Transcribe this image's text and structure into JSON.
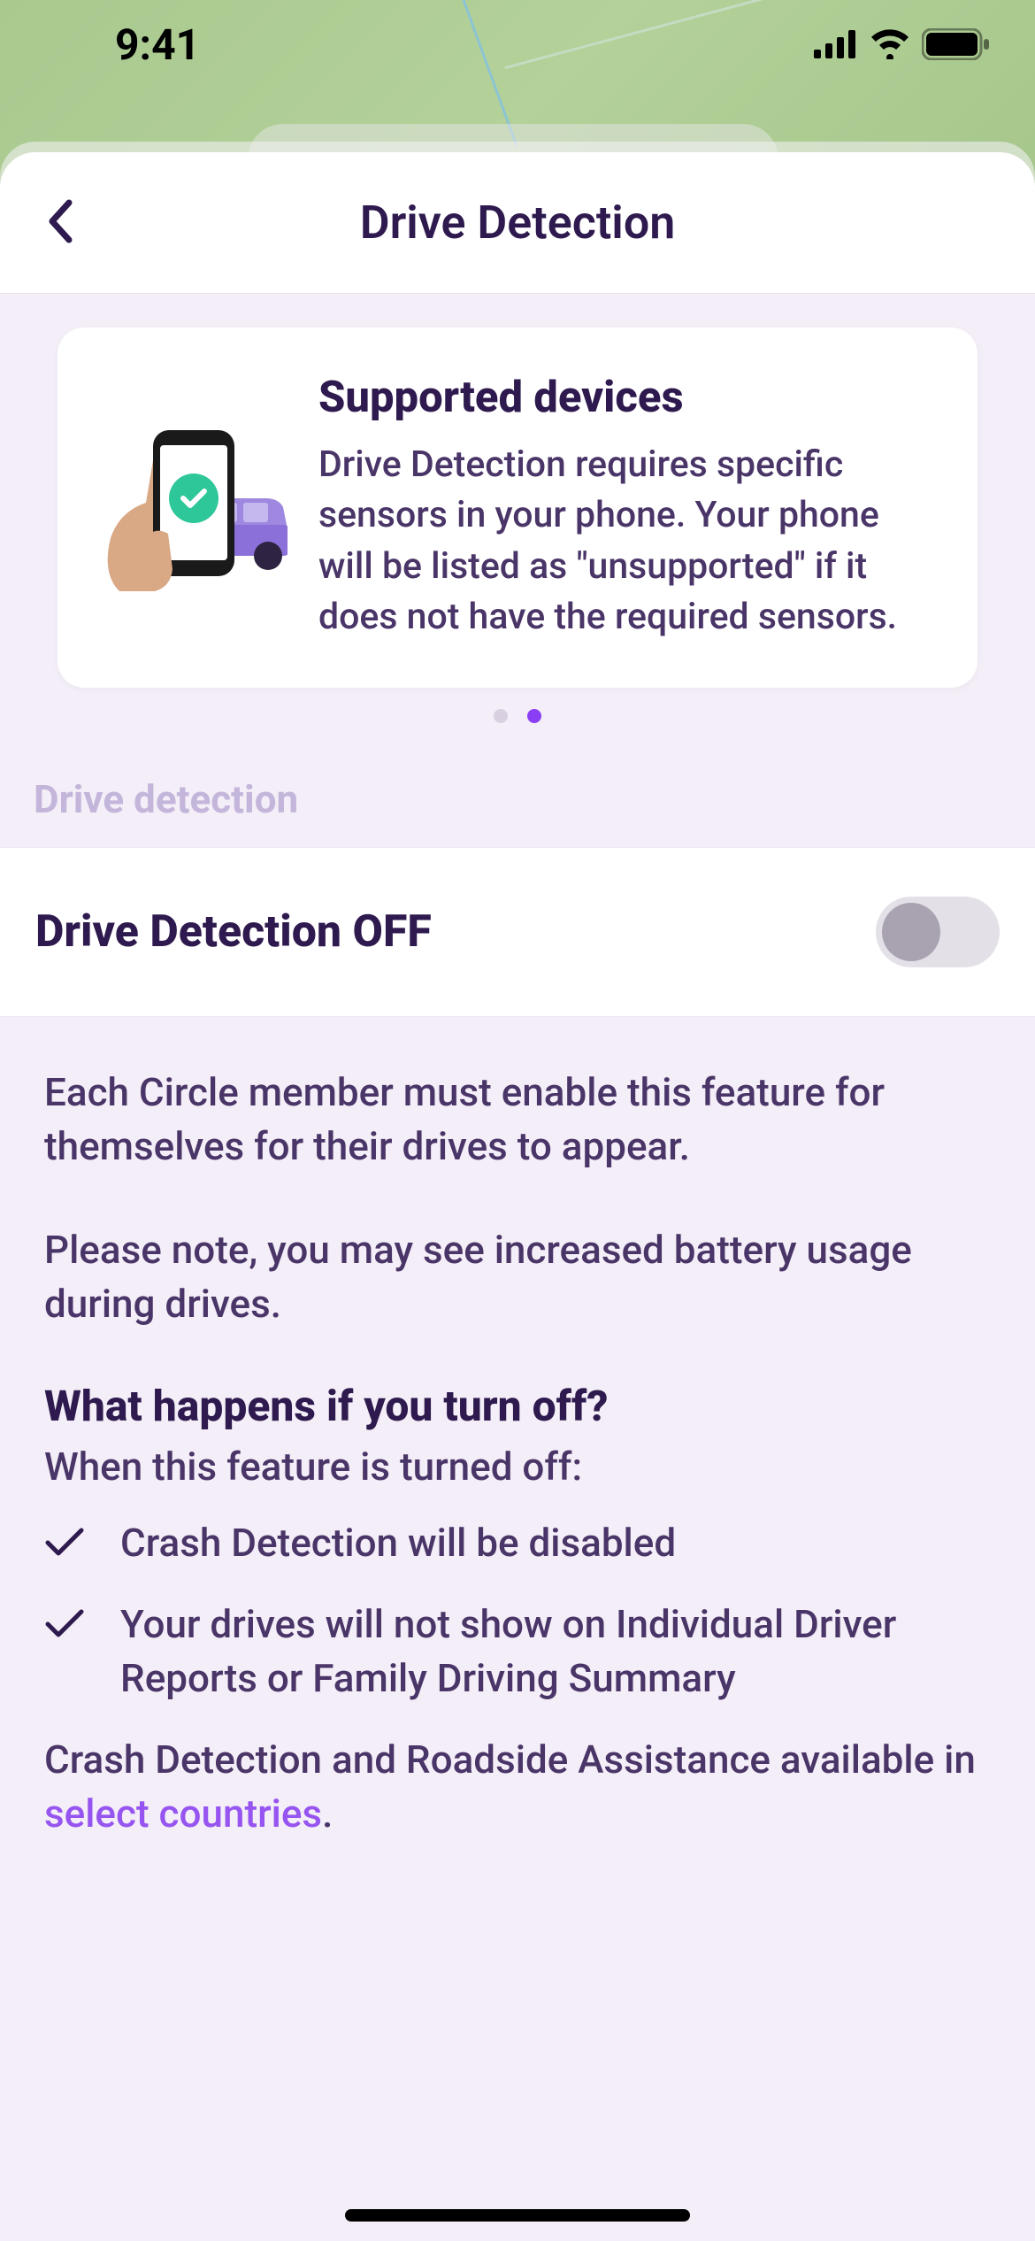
{
  "statusBar": {
    "time": "9:41"
  },
  "header": {
    "title": "Drive Detection"
  },
  "card": {
    "title": "Supported devices",
    "body": "Drive Detection requires specific sensors in your phone. Your phone will be listed as \"unsupported\" if it does not have the required sensors."
  },
  "section": {
    "label": "Drive detection",
    "toggleLabel": "Drive Detection OFF"
  },
  "info": {
    "para1": "Each Circle member must enable this feature for themselves for their drives to appear.",
    "para2": "Please note, you may see increased battery usage during drives.",
    "heading": "What happens if you turn off?",
    "sub": "When this feature is turned off:",
    "bullet1": "Crash Detection will be disabled",
    "bullet2": "Your drives will not show on Individual Driver Reports or Family Driving Summary",
    "footerPrefix": "Crash Detection and Roadside Assistance available in ",
    "footerLink": "select countries",
    "footerSuffix": "."
  }
}
